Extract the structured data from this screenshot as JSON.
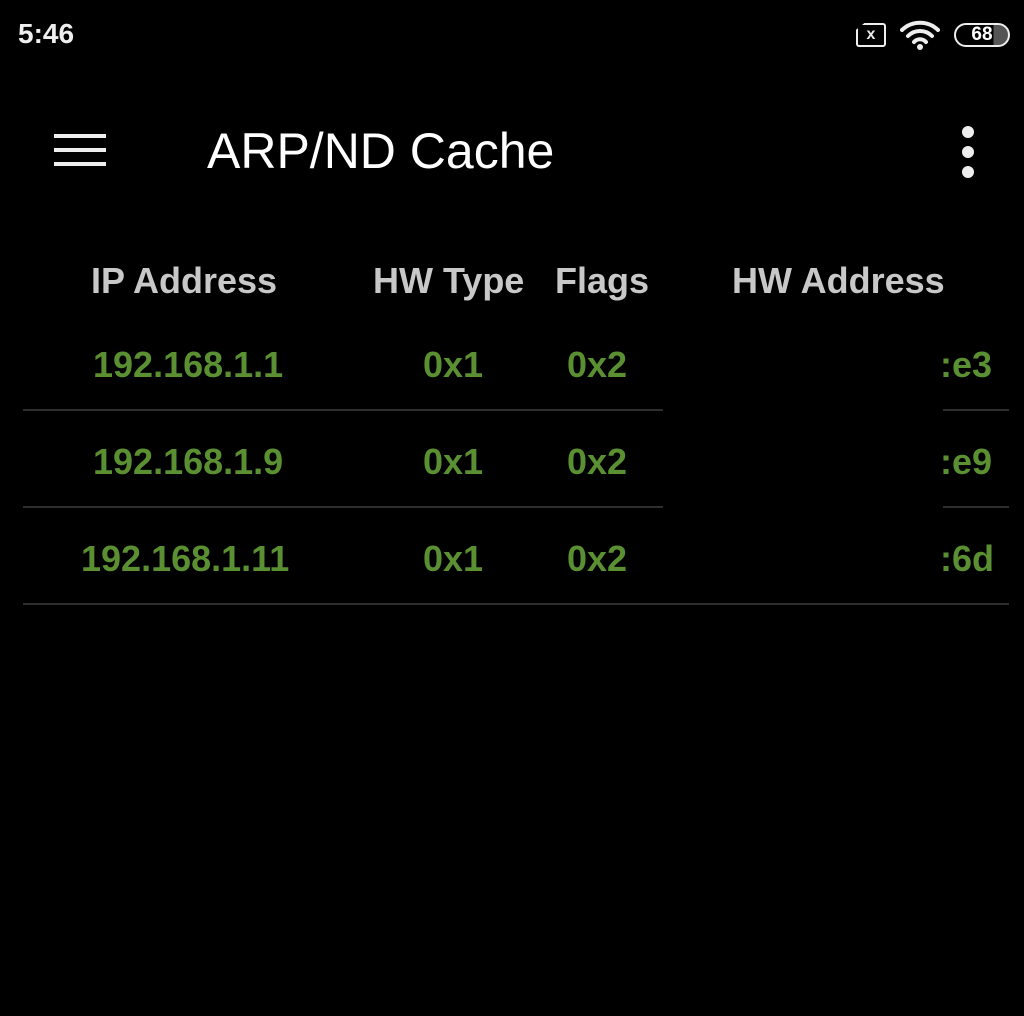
{
  "status_bar": {
    "time": "5:46",
    "sim_label": "x",
    "battery": "68"
  },
  "toolbar": {
    "title": "ARP/ND Cache"
  },
  "table": {
    "headers": [
      "IP Address",
      "HW Type",
      "Flags",
      "HW Address"
    ],
    "rows": [
      {
        "ip": "192.168.1.1",
        "hw_type": "0x1",
        "flags": "0x2",
        "hw_address": ":e3"
      },
      {
        "ip": "192.168.1.9",
        "hw_type": "0x1",
        "flags": "0x2",
        "hw_address": ":e9"
      },
      {
        "ip": "192.168.1.11",
        "hw_type": "0x1",
        "flags": "0x2",
        "hw_address": ":6d"
      }
    ]
  },
  "colors": {
    "header_text": "#c8c8c8",
    "value_text": "#5a8f32",
    "background": "#000000"
  }
}
